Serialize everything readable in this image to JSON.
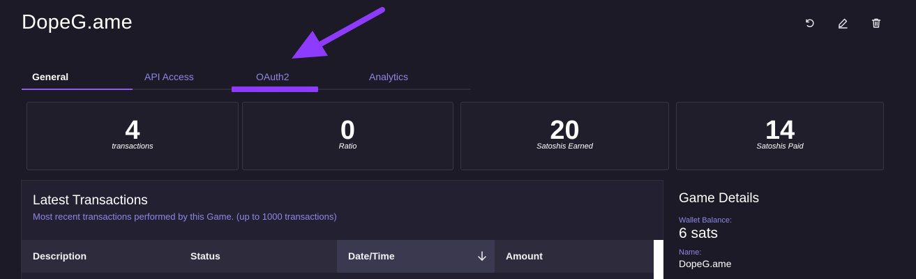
{
  "page": {
    "title": "DopeG.ame"
  },
  "header_actions": [
    {
      "name": "refresh-icon",
      "label": "Refresh"
    },
    {
      "name": "edit-icon",
      "label": "Edit"
    },
    {
      "name": "trash-icon",
      "label": "Delete"
    }
  ],
  "tabs": [
    {
      "label": "General",
      "active": true
    },
    {
      "label": "API Access",
      "active": false
    },
    {
      "label": "OAuth2",
      "active": false
    },
    {
      "label": "Analytics",
      "active": false
    }
  ],
  "stats": [
    {
      "value": "4",
      "label": "transactions"
    },
    {
      "value": "0",
      "label": "Ratio"
    },
    {
      "value": "20",
      "label": "Satoshis Earned"
    },
    {
      "value": "14",
      "label": "Satoshis Paid"
    }
  ],
  "transactions": {
    "title": "Latest Transactions",
    "subtitle": "Most recent transactions performed by this Game. (up to 1000 transactions)",
    "columns": [
      "Description",
      "Status",
      "Date/Time",
      "Amount"
    ],
    "sorted_column": "Date/Time",
    "sort_direction": "descending"
  },
  "game_details": {
    "title": "Game Details",
    "wallet_balance_label": "Wallet Balance:",
    "wallet_balance_value": "6 sats",
    "name_label": "Name:",
    "name_value": "DopeG.ame"
  },
  "colors": {
    "background": "#1c1a26",
    "accent": "#8b5cf6",
    "annotation": "#8d3cff",
    "tab_text": "#8f86e6"
  }
}
